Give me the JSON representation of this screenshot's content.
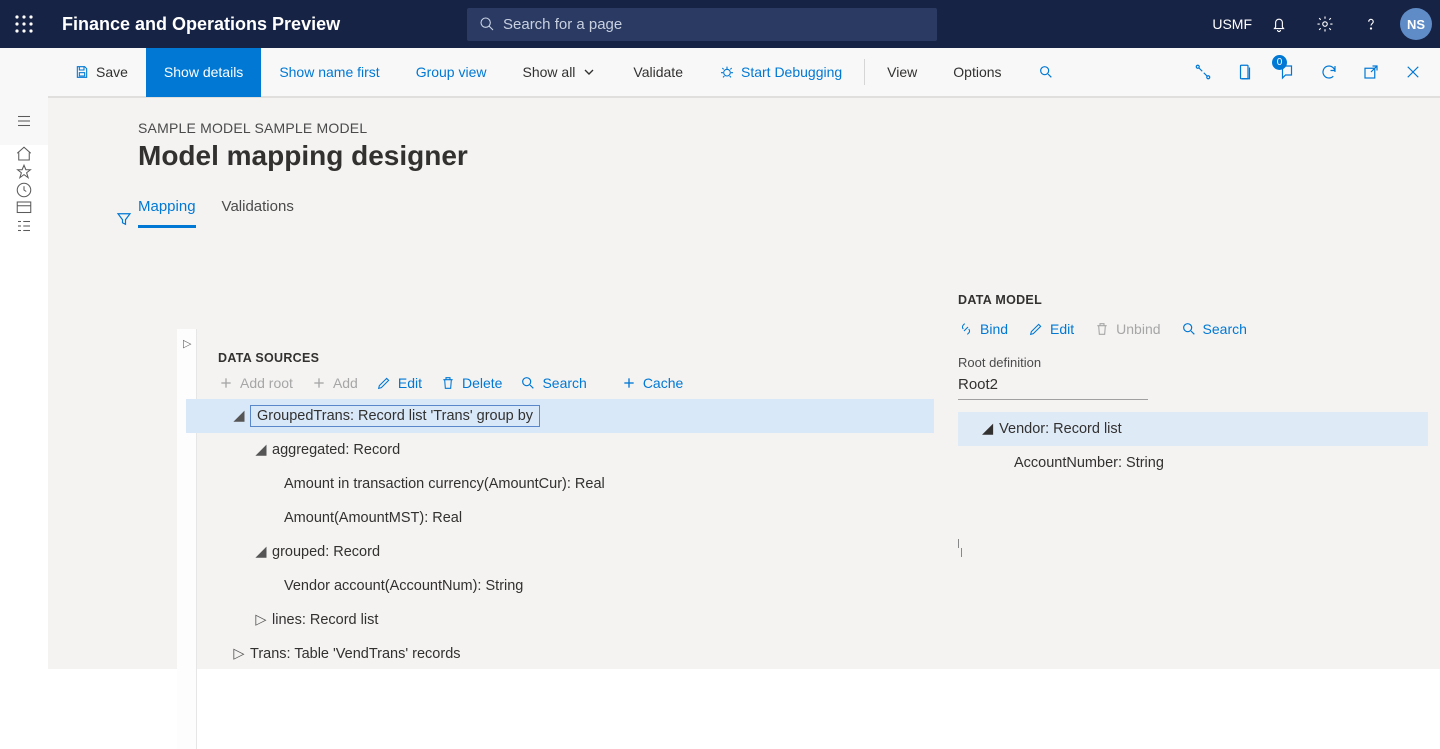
{
  "top": {
    "app_title": "Finance and Operations Preview",
    "search_placeholder": "Search for a page",
    "company": "USMF",
    "avatar_initials": "NS"
  },
  "action": {
    "save": "Save",
    "show_details": "Show details",
    "show_name_first": "Show name first",
    "group_view": "Group view",
    "show_all": "Show all",
    "validate": "Validate",
    "start_debugging": "Start Debugging",
    "view": "View",
    "options": "Options",
    "badge0": "0"
  },
  "page": {
    "breadcrumb": "SAMPLE MODEL SAMPLE MODEL",
    "title": "Model mapping designer",
    "tab_mapping": "Mapping",
    "tab_validations": "Validations"
  },
  "ds": {
    "heading": "DATA SOURCES",
    "add_root": "Add root",
    "add": "Add",
    "edit": "Edit",
    "delete": "Delete",
    "search": "Search",
    "cache": "Cache",
    "tree": {
      "grouped_trans": "GroupedTrans: Record list 'Trans' group by",
      "aggregated": "aggregated: Record",
      "amount_cur": "Amount in transaction currency(AmountCur): Real",
      "amount_mst": "Amount(AmountMST): Real",
      "grouped": "grouped: Record",
      "vendor_account": "Vendor account(AccountNum): String",
      "lines": "lines: Record list",
      "trans": "Trans: Table 'VendTrans' records"
    }
  },
  "dm": {
    "heading": "DATA MODEL",
    "bind": "Bind",
    "edit": "Edit",
    "unbind": "Unbind",
    "search": "Search",
    "root_label": "Root definition",
    "root_value": "Root2",
    "tree": {
      "vendor": "Vendor: Record list",
      "account_number": "AccountNumber: String"
    }
  }
}
